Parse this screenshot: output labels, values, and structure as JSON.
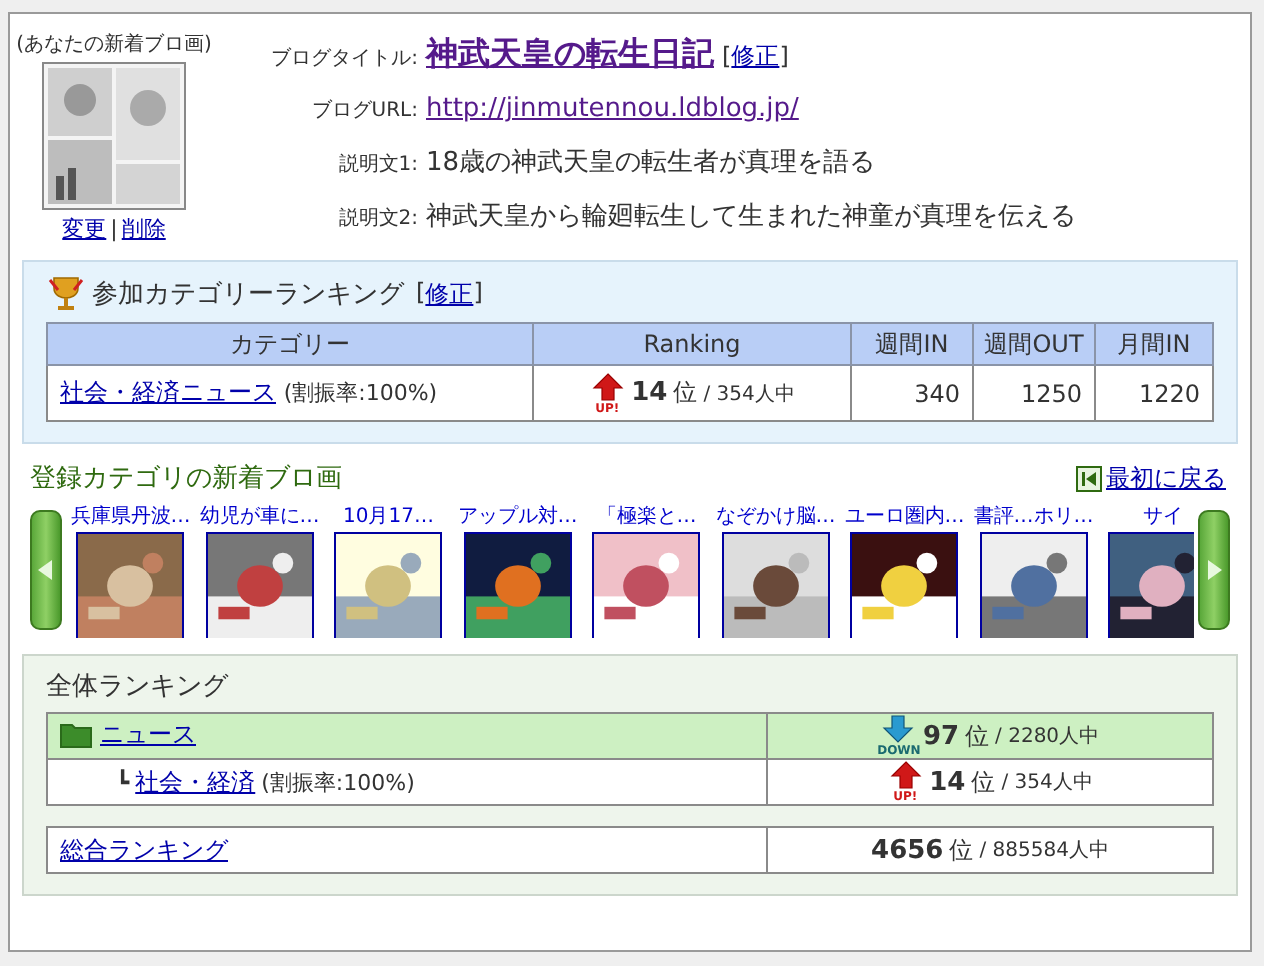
{
  "blog_comic": {
    "caption": "(あなたの新着ブロ画)",
    "links": [
      "変更",
      "削除"
    ],
    "separator": "|"
  },
  "blog_info": {
    "title_label": "ブログタイトル:",
    "title": "神武天皇の転生日記",
    "edit": {
      "open": "[",
      "label": "修正",
      "close": "]"
    },
    "url_label": "ブログURL:",
    "url": "http://jinmutennou.ldblog.jp/",
    "descriptions": [
      {
        "label": "説明文1:",
        "text": "18歳の神武天皇の転生者が真理を語る"
      },
      {
        "label": "説明文2:",
        "text": "神武天皇から輪廻転生して生まれた神童が真理を伝える"
      }
    ]
  },
  "category_ranking": {
    "title": "参加カテゴリーランキング",
    "edit": {
      "open": "[",
      "label": "修正",
      "close": "]"
    },
    "columns": [
      "カテゴリー",
      "Ranking",
      "週間IN",
      "週間OUT",
      "月間IN"
    ],
    "rows": [
      {
        "category": "社会・経済ニュース",
        "share": "(割振率:100%)",
        "rising": true,
        "trend_label": "UP!",
        "rank": "14",
        "rank_unit": "位",
        "total": "/ 354人中",
        "weekly_in": "340",
        "weekly_out": "1250",
        "monthly_in": "1220"
      }
    ]
  },
  "new_comics": {
    "title": "登録カテゴリの新着ブロ画",
    "back_link": "最初に戻る",
    "items": [
      {
        "title": "兵庫県丹波…"
      },
      {
        "title": "幼児が車に…"
      },
      {
        "title": "10月17…"
      },
      {
        "title": "アップル対…"
      },
      {
        "title": "「極楽と…"
      },
      {
        "title": "なぞかけ脳…"
      },
      {
        "title": "ユーロ圏内…"
      },
      {
        "title": "書評…ホリ…"
      },
      {
        "title": "サイ"
      }
    ]
  },
  "overall_ranking": {
    "title": "全体ランキング",
    "rows": [
      {
        "kind": "category",
        "name": "ニュース",
        "rising": false,
        "trend_label": "DOWN",
        "rank": "97",
        "rank_unit": "位",
        "total": "/ 2280人中"
      },
      {
        "kind": "subcategory",
        "branch": "┗",
        "name": "社会・経済",
        "share": "(割振率:100%)",
        "rising": true,
        "trend_label": "UP!",
        "rank": "14",
        "rank_unit": "位",
        "total": "/ 354人中"
      }
    ],
    "total": {
      "name": "総合ランキング",
      "rank": "4656",
      "rank_unit": "位",
      "total": "/ 885584人中"
    }
  }
}
